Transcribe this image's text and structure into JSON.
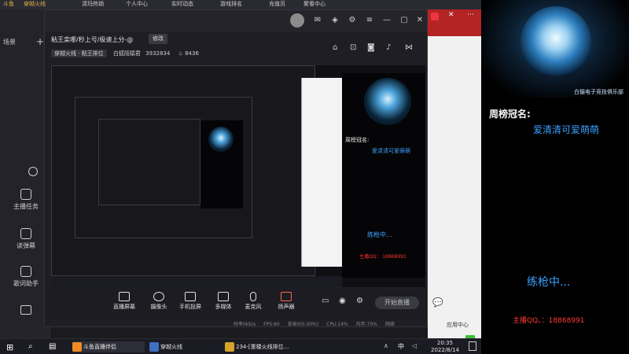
{
  "top_strip": {
    "left_tabs": [
      "斗鱼",
      "穿越火线"
    ],
    "tabs": [
      "清玛热销",
      "个人中心",
      "实时动态",
      "游戏排名",
      "充值页",
      "聚看中心"
    ]
  },
  "sidebar": {
    "header_label": "场景",
    "items": [
      {
        "label": "主播任务"
      },
      {
        "label": "读弹幕"
      },
      {
        "label": "歌词助手"
      }
    ]
  },
  "main_window": {
    "room_title": "粘王栾哪/秒上号/极速上分-@",
    "edit_label": "修改",
    "category": "穿越火线 · 粘王排位",
    "views_label": "白狐陌猿君",
    "views_value": "3932834",
    "heat_value": "8436",
    "toolbar": [
      {
        "label": "直播屏幕"
      },
      {
        "label": "摄像头"
      },
      {
        "label": "手机投屏"
      },
      {
        "label": "多媒体"
      },
      {
        "label": "麦克风"
      },
      {
        "label": "扬声器"
      }
    ],
    "start_live_label": "开始直播",
    "status": [
      "码率0kb/s",
      "FPS:60",
      "丢帧0(0.00%)",
      "CPU:14%",
      "内存:70%",
      "网络"
    ]
  },
  "preview": {
    "nested_weekly_title": "周榜冠名:",
    "nested_weekly_name": "爱清清可爱萌萌",
    "nested_practicing": "练枪中...",
    "nested_qq": "主播QQ： 18868991"
  },
  "browser": {
    "app_center": "应用中心",
    "page": "1"
  },
  "overlay": {
    "club_name": "白猫电子竞技俱乐部",
    "weekly_title": "周榜冠名:",
    "weekly_name": "爱清清可爱萌萌",
    "practicing": "练枪中...",
    "streamer_qq": "主播QQ。：18868991",
    "colors": {
      "accent_blue": "#3aa0ff",
      "accent_red": "#ff3a3a"
    }
  },
  "taskbar": {
    "apps": [
      {
        "label": "斗鱼直播伴侣",
        "color": "#f08a24"
      },
      {
        "label": "穿越火线",
        "color": "#3f6fbf"
      },
      {
        "label": "234-[重楼火线排位...",
        "color": "#d6a42b"
      }
    ],
    "input_method": "中",
    "time": "20:35",
    "date": "2022/8/14"
  }
}
